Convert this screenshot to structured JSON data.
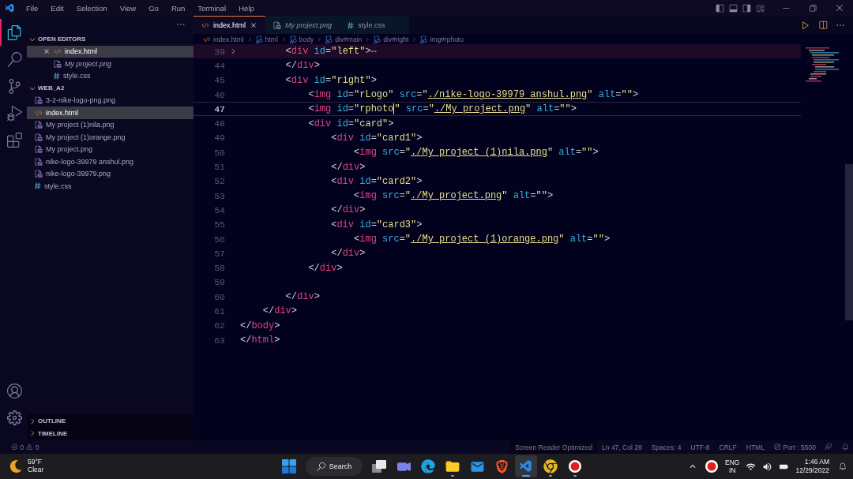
{
  "title_bar": {
    "menu": [
      "File",
      "Edit",
      "Selection",
      "View",
      "Go",
      "Run",
      "Terminal",
      "Help"
    ]
  },
  "activity_bar": {
    "top": [
      {
        "kind": "explorer",
        "selected": true
      },
      {
        "kind": "search",
        "selected": false
      },
      {
        "kind": "source-control",
        "selected": false
      },
      {
        "kind": "run-debug",
        "selected": false
      },
      {
        "kind": "extensions",
        "selected": false
      }
    ],
    "bottom": [
      {
        "kind": "account"
      },
      {
        "kind": "settings"
      }
    ]
  },
  "sidebar": {
    "sections": [
      {
        "kind": "open-editors",
        "title": "OPEN EDITORS",
        "expanded": true,
        "items": [
          {
            "name": "index.html",
            "kind": "html",
            "selected": true,
            "preview": false
          },
          {
            "name": "My project.png",
            "kind": "image",
            "selected": false,
            "preview": true
          },
          {
            "name": "style.css",
            "kind": "css",
            "selected": false,
            "preview": false
          }
        ]
      },
      {
        "kind": "folder",
        "title": "WEB_A2",
        "expanded": true,
        "items": [
          {
            "name": "3-2-nike-logo-png.png",
            "kind": "image",
            "selected": false
          },
          {
            "name": "index.html",
            "kind": "html",
            "selected": true
          },
          {
            "name": "My project (1)nila.png",
            "kind": "image",
            "selected": false
          },
          {
            "name": "My project (1)orange.png",
            "kind": "image",
            "selected": false
          },
          {
            "name": "My project.png",
            "kind": "image",
            "selected": false
          },
          {
            "name": "nike-logo-39979 anshul.png",
            "kind": "image",
            "selected": false
          },
          {
            "name": "nike-logo-39979.png",
            "kind": "image",
            "selected": false
          },
          {
            "name": "style.css",
            "kind": "css",
            "selected": false
          }
        ]
      }
    ],
    "collapsed_sections": [
      {
        "title": "OUTLINE",
        "expanded": false
      },
      {
        "title": "TIMELINE",
        "expanded": false
      }
    ]
  },
  "editor": {
    "tabs": [
      {
        "label": "index.html",
        "kind": "html",
        "selected": true,
        "preview": false
      },
      {
        "label": "My project.png",
        "kind": "image",
        "selected": false,
        "preview": true
      },
      {
        "label": "style.css",
        "kind": "css",
        "selected": false,
        "preview": false
      }
    ],
    "breadcrumbs": [
      {
        "label": "index.html",
        "kind": "html"
      },
      {
        "label": "html",
        "kind": "element"
      },
      {
        "label": "body",
        "kind": "element"
      },
      {
        "label": "div#main",
        "kind": "element"
      },
      {
        "label": "div#right",
        "kind": "element"
      },
      {
        "label": "img#rphoto",
        "kind": "element"
      }
    ],
    "lines": [
      {
        "number": "39",
        "current": false,
        "folded": true,
        "tokens": [
          {
            "kind": "punct",
            "text": "        <"
          },
          {
            "kind": "tag",
            "text": "div"
          },
          {
            "kind": "attr",
            "text": " id"
          },
          {
            "kind": "punct",
            "text": "="
          },
          {
            "kind": "string",
            "text": "\"left\""
          },
          {
            "kind": "punct",
            "text": ">"
          },
          {
            "kind": "ellipsis",
            "text": "⋯"
          }
        ]
      },
      {
        "number": "44",
        "current": false,
        "folded": false,
        "tokens": [
          {
            "kind": "punct",
            "text": "        </"
          },
          {
            "kind": "tag",
            "text": "div"
          },
          {
            "kind": "punct",
            "text": ">"
          }
        ]
      },
      {
        "number": "45",
        "current": false,
        "folded": false,
        "tokens": [
          {
            "kind": "punct",
            "text": "        <"
          },
          {
            "kind": "tag",
            "text": "div"
          },
          {
            "kind": "attr",
            "text": " id"
          },
          {
            "kind": "punct",
            "text": "="
          },
          {
            "kind": "string",
            "text": "\"right\""
          },
          {
            "kind": "punct",
            "text": ">"
          }
        ]
      },
      {
        "number": "46",
        "current": false,
        "folded": false,
        "tokens": [
          {
            "kind": "punct",
            "text": "            <"
          },
          {
            "kind": "tag",
            "text": "img"
          },
          {
            "kind": "attr",
            "text": " id"
          },
          {
            "kind": "punct",
            "text": "="
          },
          {
            "kind": "string",
            "text": "\"rLogo\""
          },
          {
            "kind": "attr",
            "text": " src"
          },
          {
            "kind": "punct",
            "text": "="
          },
          {
            "kind": "string",
            "text": "\""
          },
          {
            "kind": "link",
            "text": "./nike-logo-39979 anshul.png"
          },
          {
            "kind": "string",
            "text": "\""
          },
          {
            "kind": "attr",
            "text": " alt"
          },
          {
            "kind": "punct",
            "text": "="
          },
          {
            "kind": "string",
            "text": "\"\""
          },
          {
            "kind": "punct",
            "text": ">"
          }
        ]
      },
      {
        "number": "47",
        "current": true,
        "folded": false,
        "tokens": [
          {
            "kind": "punct",
            "text": "            <"
          },
          {
            "kind": "tag",
            "text": "img"
          },
          {
            "kind": "attr",
            "text": " id"
          },
          {
            "kind": "punct",
            "text": "="
          },
          {
            "kind": "string",
            "text": "\"rphoto"
          },
          {
            "kind": "caret"
          },
          {
            "kind": "string",
            "text": "\""
          },
          {
            "kind": "attr",
            "text": " src"
          },
          {
            "kind": "punct",
            "text": "="
          },
          {
            "kind": "string",
            "text": "\""
          },
          {
            "kind": "link",
            "text": "./My project.png"
          },
          {
            "kind": "string",
            "text": "\""
          },
          {
            "kind": "attr",
            "text": " alt"
          },
          {
            "kind": "punct",
            "text": "="
          },
          {
            "kind": "string",
            "text": "\"\""
          },
          {
            "kind": "punct",
            "text": ">"
          }
        ]
      },
      {
        "number": "48",
        "current": false,
        "folded": false,
        "tokens": [
          {
            "kind": "punct",
            "text": "            <"
          },
          {
            "kind": "tag",
            "text": "div"
          },
          {
            "kind": "attr",
            "text": " id"
          },
          {
            "kind": "punct",
            "text": "="
          },
          {
            "kind": "string",
            "text": "\"card\""
          },
          {
            "kind": "punct",
            "text": ">"
          }
        ]
      },
      {
        "number": "49",
        "current": false,
        "folded": false,
        "tokens": [
          {
            "kind": "punct",
            "text": "                <"
          },
          {
            "kind": "tag",
            "text": "div"
          },
          {
            "kind": "attr",
            "text": " id"
          },
          {
            "kind": "punct",
            "text": "="
          },
          {
            "kind": "string",
            "text": "\"card1\""
          },
          {
            "kind": "punct",
            "text": ">"
          }
        ]
      },
      {
        "number": "50",
        "current": false,
        "folded": false,
        "tokens": [
          {
            "kind": "punct",
            "text": "                    <"
          },
          {
            "kind": "tag",
            "text": "img"
          },
          {
            "kind": "attr",
            "text": " src"
          },
          {
            "kind": "punct",
            "text": "="
          },
          {
            "kind": "string",
            "text": "\""
          },
          {
            "kind": "link",
            "text": "./My project (1)nila.png"
          },
          {
            "kind": "string",
            "text": "\""
          },
          {
            "kind": "attr",
            "text": " alt"
          },
          {
            "kind": "punct",
            "text": "="
          },
          {
            "kind": "string",
            "text": "\"\""
          },
          {
            "kind": "punct",
            "text": ">"
          }
        ]
      },
      {
        "number": "51",
        "current": false,
        "folded": false,
        "tokens": [
          {
            "kind": "punct",
            "text": "                </"
          },
          {
            "kind": "tag",
            "text": "div"
          },
          {
            "kind": "punct",
            "text": ">"
          }
        ]
      },
      {
        "number": "52",
        "current": false,
        "folded": false,
        "tokens": [
          {
            "kind": "punct",
            "text": "                <"
          },
          {
            "kind": "tag",
            "text": "div"
          },
          {
            "kind": "attr",
            "text": " id"
          },
          {
            "kind": "punct",
            "text": "="
          },
          {
            "kind": "string",
            "text": "\"card2\""
          },
          {
            "kind": "punct",
            "text": ">"
          }
        ]
      },
      {
        "number": "53",
        "current": false,
        "folded": false,
        "tokens": [
          {
            "kind": "punct",
            "text": "                    <"
          },
          {
            "kind": "tag",
            "text": "img"
          },
          {
            "kind": "attr",
            "text": " src"
          },
          {
            "kind": "punct",
            "text": "="
          },
          {
            "kind": "string",
            "text": "\""
          },
          {
            "kind": "link",
            "text": "./My project.png"
          },
          {
            "kind": "string",
            "text": "\""
          },
          {
            "kind": "attr",
            "text": " alt"
          },
          {
            "kind": "punct",
            "text": "="
          },
          {
            "kind": "string",
            "text": "\"\""
          },
          {
            "kind": "punct",
            "text": ">"
          }
        ]
      },
      {
        "number": "54",
        "current": false,
        "folded": false,
        "tokens": [
          {
            "kind": "punct",
            "text": "                </"
          },
          {
            "kind": "tag",
            "text": "div"
          },
          {
            "kind": "punct",
            "text": ">"
          }
        ]
      },
      {
        "number": "55",
        "current": false,
        "folded": false,
        "tokens": [
          {
            "kind": "punct",
            "text": "                <"
          },
          {
            "kind": "tag",
            "text": "div"
          },
          {
            "kind": "attr",
            "text": " id"
          },
          {
            "kind": "punct",
            "text": "="
          },
          {
            "kind": "string",
            "text": "\"card3\""
          },
          {
            "kind": "punct",
            "text": ">"
          }
        ]
      },
      {
        "number": "56",
        "current": false,
        "folded": false,
        "tokens": [
          {
            "kind": "punct",
            "text": "                    <"
          },
          {
            "kind": "tag",
            "text": "img"
          },
          {
            "kind": "attr",
            "text": " src"
          },
          {
            "kind": "punct",
            "text": "="
          },
          {
            "kind": "string",
            "text": "\""
          },
          {
            "kind": "link",
            "text": "./My project (1)orange.png"
          },
          {
            "kind": "string",
            "text": "\""
          },
          {
            "kind": "attr",
            "text": " alt"
          },
          {
            "kind": "punct",
            "text": "="
          },
          {
            "kind": "string",
            "text": "\"\""
          },
          {
            "kind": "punct",
            "text": ">"
          }
        ]
      },
      {
        "number": "57",
        "current": false,
        "folded": false,
        "tokens": [
          {
            "kind": "punct",
            "text": "                </"
          },
          {
            "kind": "tag",
            "text": "div"
          },
          {
            "kind": "punct",
            "text": ">"
          }
        ]
      },
      {
        "number": "58",
        "current": false,
        "folded": false,
        "tokens": [
          {
            "kind": "punct",
            "text": "            </"
          },
          {
            "kind": "tag",
            "text": "div"
          },
          {
            "kind": "punct",
            "text": ">"
          }
        ]
      },
      {
        "number": "59",
        "current": false,
        "folded": false
      },
      {
        "number": "60",
        "current": false,
        "folded": false,
        "tokens": [
          {
            "kind": "punct",
            "text": "        </"
          },
          {
            "kind": "tag",
            "text": "div"
          },
          {
            "kind": "punct",
            "text": ">"
          }
        ]
      },
      {
        "number": "61",
        "current": false,
        "folded": false,
        "tokens": [
          {
            "kind": "punct",
            "text": "    </"
          },
          {
            "kind": "tag",
            "text": "div"
          },
          {
            "kind": "punct",
            "text": ">"
          }
        ]
      },
      {
        "number": "62",
        "current": false,
        "folded": false,
        "tokens": [
          {
            "kind": "punct",
            "text": "</"
          },
          {
            "kind": "tag",
            "text": "body"
          },
          {
            "kind": "punct",
            "text": ">"
          }
        ]
      },
      {
        "number": "63",
        "current": false,
        "folded": false,
        "tokens": [
          {
            "kind": "punct",
            "text": "</"
          },
          {
            "kind": "tag",
            "text": "html"
          },
          {
            "kind": "punct",
            "text": ">"
          }
        ]
      }
    ]
  },
  "status_bar": {
    "problems": {
      "errors": "0",
      "warnings": "0"
    },
    "items": [
      {
        "text": "Screen Reader Optimized",
        "kind": "highlight"
      },
      {
        "text": "Ln 47, Col 28",
        "kind": "plain"
      },
      {
        "text": "Spaces: 4",
        "kind": "plain"
      },
      {
        "text": "UTF-8",
        "kind": "plain"
      },
      {
        "text": "CRLF",
        "kind": "plain"
      },
      {
        "text": "HTML",
        "kind": "plain"
      },
      {
        "text": "Port : 5500",
        "kind": "port"
      }
    ]
  },
  "taskbar": {
    "weather": {
      "temperature": "59°F",
      "condition": "Clear"
    },
    "apps": [
      {
        "kind": "start",
        "running": false,
        "selected": false
      },
      {
        "kind": "search",
        "label": "Search"
      },
      {
        "kind": "task-view",
        "running": false,
        "selected": false
      },
      {
        "kind": "chat",
        "running": false,
        "selected": false
      },
      {
        "kind": "edge",
        "running": false,
        "selected": false
      },
      {
        "kind": "explorer",
        "running": true,
        "selected": false
      },
      {
        "kind": "mail",
        "running": false,
        "selected": false
      },
      {
        "kind": "brave",
        "running": false,
        "selected": false
      },
      {
        "kind": "vscode",
        "running": true,
        "selected": true
      },
      {
        "kind": "chrome",
        "running": true,
        "selected": false
      },
      {
        "kind": "recorder",
        "running": true,
        "selected": false
      }
    ],
    "tray": {
      "language": "ENG",
      "region": "IN",
      "time": "1:46 AM",
      "date": "12/29/2022"
    }
  }
}
